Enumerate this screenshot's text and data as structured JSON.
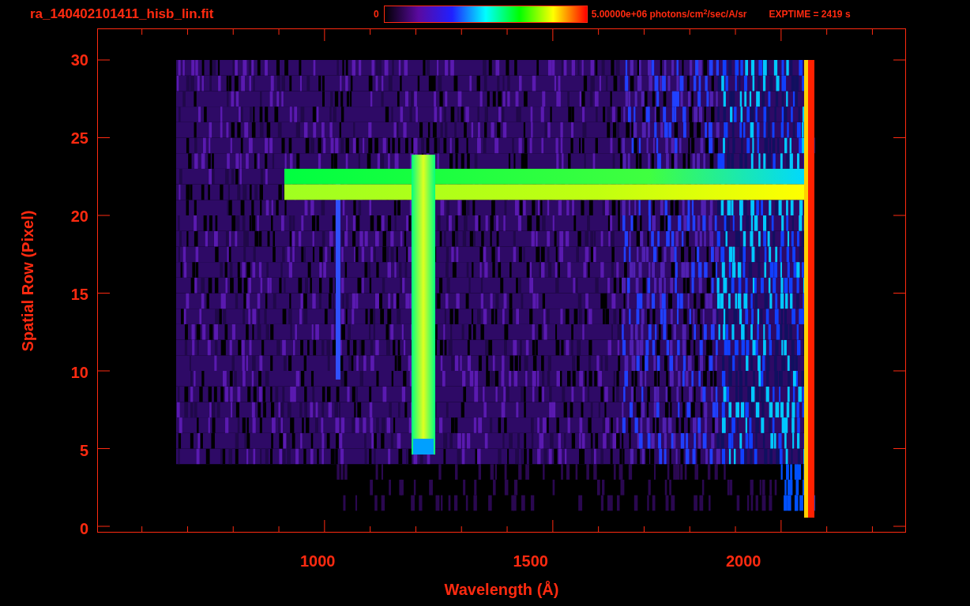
{
  "title": "ra_140402101411_hisb_lin.fit",
  "colorbar": {
    "min_label": "0",
    "max_label": "5.00000e+06 photons/cm$^{2}$/sec/A/sr"
  },
  "exposure": "EXPTIME = 2419 s",
  "plot": {
    "ylabel": "Spatial Row (Pixel)",
    "xlabel": "Wavelength (Å)",
    "yticks": [
      "30",
      "25",
      "20",
      "15",
      "10",
      "5",
      "0"
    ],
    "xticks": [
      "1000",
      "1500",
      "2000"
    ]
  }
}
